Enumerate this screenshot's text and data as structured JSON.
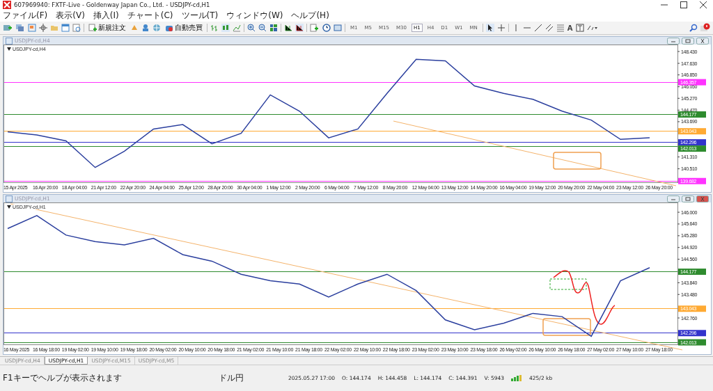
{
  "window": {
    "title": "607969940: FXTF-Live - Goldenway Japan Co., Ltd. - USDJPY-cd,H1"
  },
  "menu": [
    "ファイル(F)",
    "表示(V)",
    "挿入(I)",
    "チャート(C)",
    "ツール(T)",
    "ウィンドウ(W)",
    "ヘルプ(H)"
  ],
  "toolbar": {
    "order_button": "新規注文",
    "auto_trade_button": "自動売買",
    "text_tool": "A",
    "timeframes": [
      {
        "label": "M1",
        "selected": false
      },
      {
        "label": "M5",
        "selected": false
      },
      {
        "label": "M15",
        "selected": false
      },
      {
        "label": "M30",
        "selected": false
      },
      {
        "label": "H1",
        "selected": true
      },
      {
        "label": "H4",
        "selected": false
      },
      {
        "label": "D1",
        "selected": false
      },
      {
        "label": "W1",
        "selected": false
      },
      {
        "label": "MN",
        "selected": false
      }
    ]
  },
  "chart_windows": [
    {
      "title": "USDJPY-cd,H4",
      "label": "USDJPY-cd,H4",
      "chart_data": {
        "type": "line",
        "categories": [
          "15 Apr 2025",
          "16 Apr 20:00",
          "18 Apr 04:00",
          "21 Apr 12:00",
          "22 Apr 20:00",
          "24 Apr 04:00",
          "25 Apr 12:00",
          "28 Apr 20:00",
          "30 Apr 04:00",
          "1 May 12:00",
          "2 May 20:00",
          "6 May 04:00",
          "7 May 12:00",
          "8 May 20:00",
          "12 May 04:00",
          "13 May 12:00",
          "14 May 20:00",
          "16 May 04:00",
          "19 May 12:00",
          "20 May 20:00",
          "22 May 04:00",
          "23 May 12:00",
          "26 May 20:00"
        ],
        "series": [
          {
            "color": "#2b3f9e",
            "values": [
              143.0,
              142.8,
              142.4,
              140.6,
              141.7,
              143.2,
              143.5,
              142.2,
              142.9,
              145.5,
              144.4,
              142.6,
              143.2,
              145.6,
              147.9,
              147.8,
              146.1,
              145.6,
              145.2,
              144.4,
              143.8,
              142.5,
              142.6
            ]
          }
        ],
        "ylim": [
          139.6,
          148.9
        ],
        "yticks": [
          {
            "value": 148.43,
            "label": "148.430"
          },
          {
            "value": 147.63,
            "label": "147.630"
          },
          {
            "value": 146.85,
            "label": "146.850"
          },
          {
            "value": 146.05,
            "label": "146.050"
          },
          {
            "value": 145.27,
            "label": "145.270"
          },
          {
            "value": 144.47,
            "label": "144.470"
          },
          {
            "value": 143.69,
            "label": "143.690"
          },
          {
            "value": 141.31,
            "label": "141.310"
          },
          {
            "value": 140.51,
            "label": "140.510"
          }
        ],
        "ref_lines": [
          {
            "axis": "y",
            "value": 146.357,
            "label": "146.357",
            "color": "#ff33ff"
          },
          {
            "axis": "y",
            "value": 144.177,
            "label": "144.177",
            "color": "#2e8b2e"
          },
          {
            "axis": "y",
            "value": 143.043,
            "label": "143.043",
            "color": "#ffaa33"
          },
          {
            "axis": "y",
            "value": 142.296,
            "label": "142.296",
            "color": "#3333cc"
          },
          {
            "axis": "y",
            "value": 142.013,
            "label": "142.013",
            "color": "#2e8b2e"
          },
          {
            "axis": "y",
            "value": 139.682,
            "label": "139.682",
            "color": "#ff33ff"
          }
        ]
      }
    },
    {
      "title": "USDJPY-cd,H1",
      "label": "USDJPY-cd,H1",
      "chart_data": {
        "type": "line",
        "categories": [
          "16 May 2025",
          "16 May 18:00",
          "19 May 02:00",
          "19 May 10:00",
          "19 May 18:00",
          "20 May 02:00",
          "20 May 10:00",
          "20 May 18:00",
          "21 May 02:00",
          "21 May 10:00",
          "21 May 18:00",
          "22 May 02:00",
          "22 May 10:00",
          "22 May 18:00",
          "23 May 02:00",
          "23 May 10:00",
          "23 May 18:00",
          "26 May 02:00",
          "26 May 10:00",
          "26 May 18:00",
          "27 May 02:00",
          "27 May 10:00",
          "27 May 18:00"
        ],
        "series": [
          {
            "color": "#2b3f9e",
            "values": [
              145.5,
              145.9,
              145.3,
              145.1,
              145.0,
              145.2,
              144.7,
              144.5,
              144.1,
              143.9,
              143.8,
              143.4,
              143.8,
              144.1,
              143.6,
              142.7,
              142.4,
              142.6,
              142.9,
              142.8,
              142.2,
              143.9,
              144.3
            ]
          }
        ],
        "ylim": [
          141.95,
          146.3
        ],
        "yticks": [
          {
            "value": 146.0,
            "label": "146.000"
          },
          {
            "value": 145.64,
            "label": "145.640"
          },
          {
            "value": 145.28,
            "label": "145.280"
          },
          {
            "value": 144.92,
            "label": "144.920"
          },
          {
            "value": 144.56,
            "label": "144.560"
          },
          {
            "value": 143.84,
            "label": "143.840"
          },
          {
            "value": 143.48,
            "label": "143.480"
          },
          {
            "value": 142.76,
            "label": "142.760"
          }
        ],
        "ref_lines": [
          {
            "axis": "y",
            "value": 144.177,
            "label": "144.177",
            "color": "#2e8b2e"
          },
          {
            "axis": "y",
            "value": 143.043,
            "label": "143.043",
            "color": "#ffaa33"
          },
          {
            "axis": "y",
            "value": 142.296,
            "label": "142.296",
            "color": "#3333cc"
          },
          {
            "axis": "y",
            "value": 142.013,
            "label": "142.013",
            "color": "#2e8b2e"
          }
        ]
      }
    }
  ],
  "chart_tabs": [
    {
      "label": "USDJPY-cd,H4",
      "selected": false
    },
    {
      "label": "USDJPY-cd,H1",
      "selected": true
    },
    {
      "label": "USDJPY-cd,M15",
      "selected": false
    },
    {
      "label": "USDJPY-cd,M5",
      "selected": false
    }
  ],
  "status_bar": {
    "help": "F1キーでヘルプが表示されます",
    "profile": "ドル円",
    "time": "2025.05.27 17:00",
    "open": "O: 144.174",
    "high": "H: 144.458",
    "low": "L: 144.174",
    "close": "C: 144.391",
    "volume": "V: 5943",
    "traffic": "425/2 kb"
  }
}
